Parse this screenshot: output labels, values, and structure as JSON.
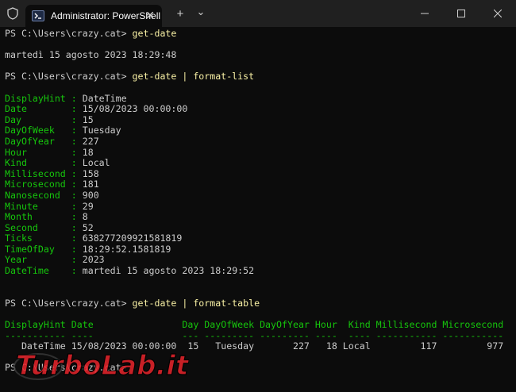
{
  "window": {
    "tab_title": "Administrator: PowerShell",
    "new_tab_label": "+",
    "dropdown_label": "⌄"
  },
  "terminal": {
    "prompt": "PS C:\\Users\\crazy.cat> ",
    "cmd1": "get-date",
    "out1": "martedì 15 agosto 2023 18:29:48",
    "cmd2": "get-date | format-list",
    "list": [
      {
        "k": "DisplayHint : ",
        "v": "DateTime"
      },
      {
        "k": "Date        : ",
        "v": "15/08/2023 00:00:00"
      },
      {
        "k": "Day         : ",
        "v": "15"
      },
      {
        "k": "DayOfWeek   : ",
        "v": "Tuesday"
      },
      {
        "k": "DayOfYear   : ",
        "v": "227"
      },
      {
        "k": "Hour        : ",
        "v": "18"
      },
      {
        "k": "Kind        : ",
        "v": "Local"
      },
      {
        "k": "Millisecond : ",
        "v": "158"
      },
      {
        "k": "Microsecond : ",
        "v": "181"
      },
      {
        "k": "Nanosecond  : ",
        "v": "900"
      },
      {
        "k": "Minute      : ",
        "v": "29"
      },
      {
        "k": "Month       : ",
        "v": "8"
      },
      {
        "k": "Second      : ",
        "v": "52"
      },
      {
        "k": "Ticks       : ",
        "v": "638277209921581819"
      },
      {
        "k": "TimeOfDay   : ",
        "v": "18:29:52.1581819"
      },
      {
        "k": "Year        : ",
        "v": "2023"
      },
      {
        "k": "DateTime    : ",
        "v": "martedì 15 agosto 2023 18:29:52"
      }
    ],
    "cmd3": "get-date | format-table",
    "table_header": "DisplayHint Date                Day DayOfWeek DayOfYear Hour  Kind Millisecond Microsecond",
    "table_sep": "----------- ----                --- --------- --------- ----  ---- ----------- -----------",
    "table_row": "   DateTime 15/08/2023 00:00:00  15   Tuesday       227   18 Local         117         977",
    "last_prompt": "PS C:\\Users\\crazy.cat> "
  },
  "watermark": {
    "text": "TurboLab.it"
  }
}
